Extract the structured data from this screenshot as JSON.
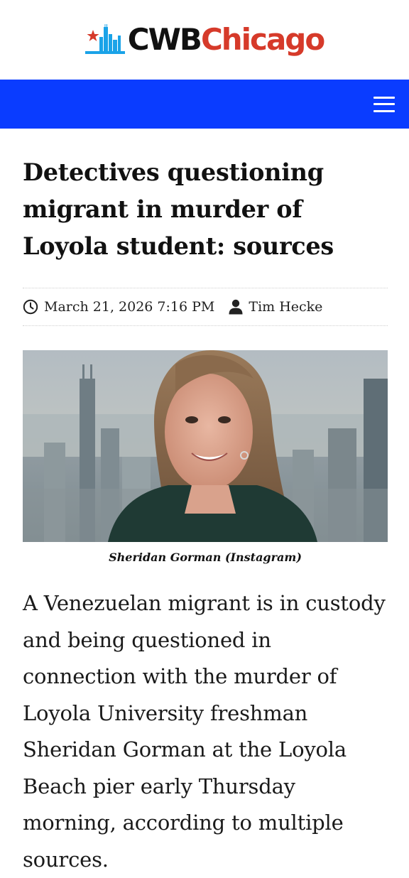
{
  "site": {
    "logo_part1": "CWB",
    "logo_part2": "Chicago",
    "logo_icon": "chicago-skyline-star-icon",
    "brand_colors": {
      "nav": "#0a3cff",
      "logo_red": "#d63a2a",
      "logo_blue": "#1aa3e8"
    }
  },
  "navbar": {
    "menu_icon": "hamburger-menu-icon"
  },
  "article": {
    "title": "Detectives questioning migrant in murder of Loyola student: sources",
    "date": "March 21, 2026 7:16 PM",
    "author": "Tim Hecke",
    "image_caption": "Sheridan Gorman (Instagram)",
    "body": "A Venezuelan migrant is in custody and being questioned in connection with the murder of Loyola University freshman Sheridan Gorman at the Loyola Beach pier early Thursday morning, according to multiple sources."
  }
}
